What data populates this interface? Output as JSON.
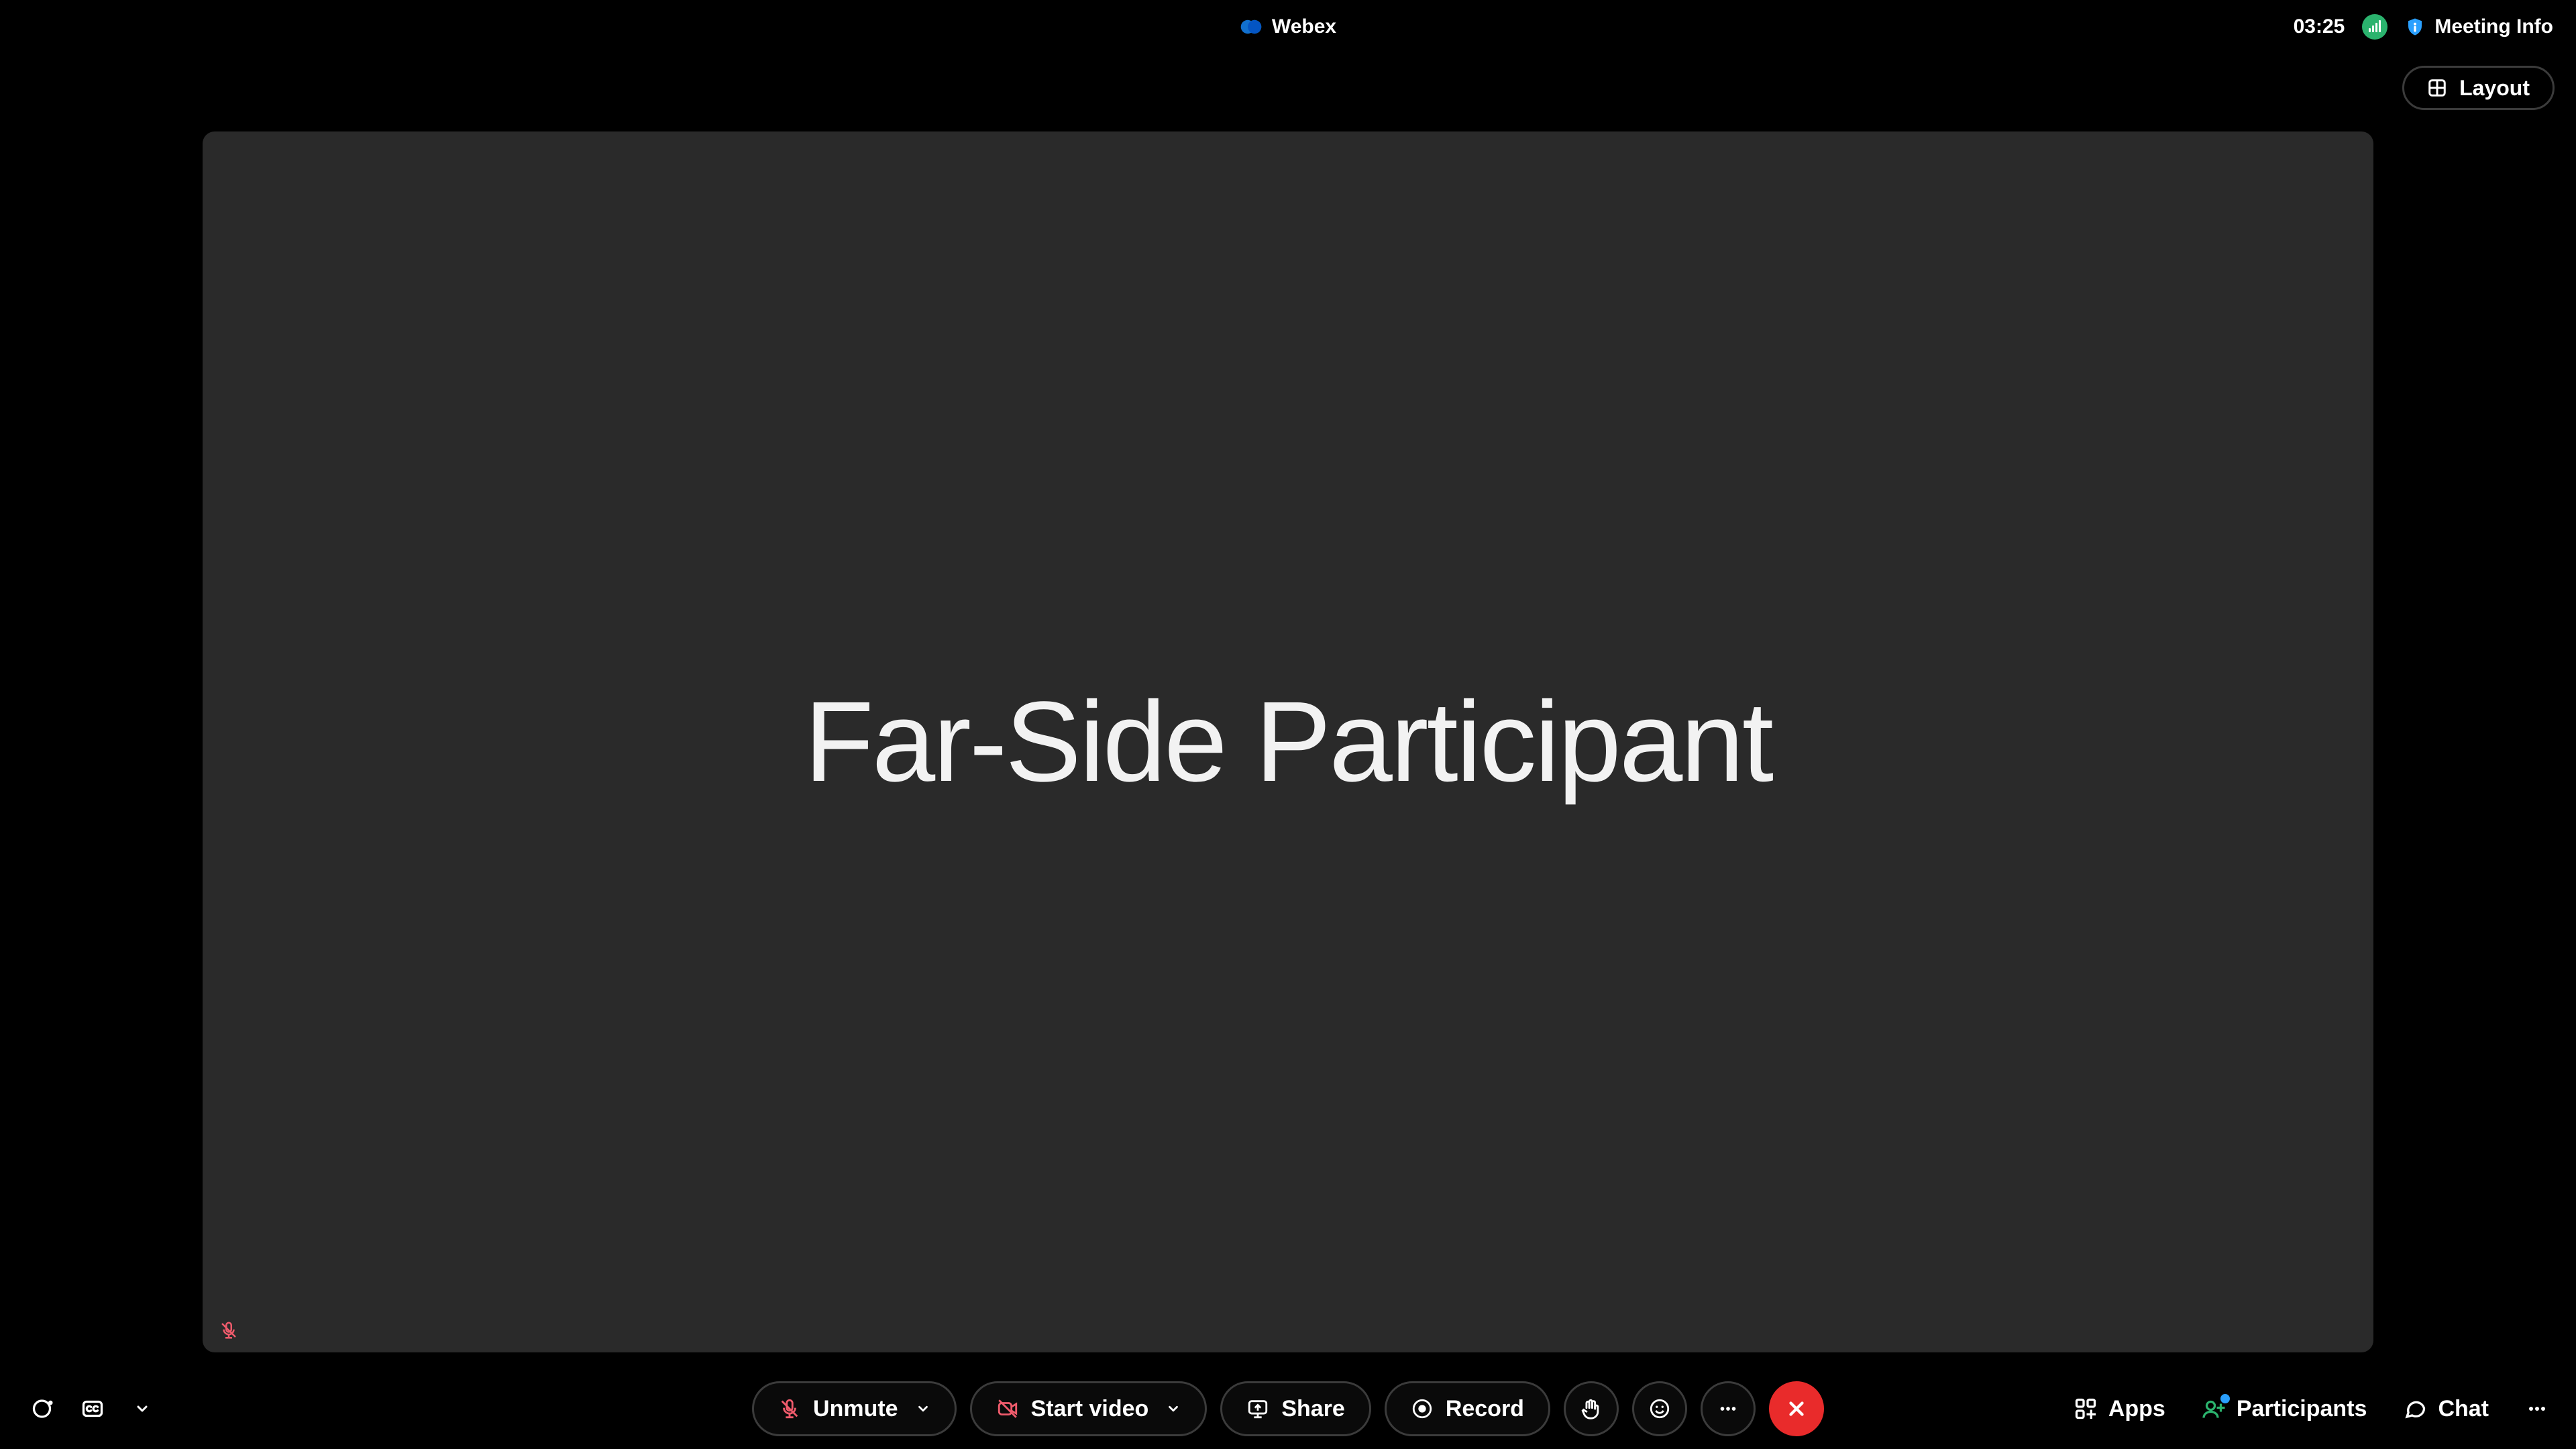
{
  "app": {
    "name": "Webex",
    "elapsed_time": "03:25",
    "meeting_info_label": "Meeting Info",
    "layout_label": "Layout"
  },
  "stage": {
    "participant_name": "Far-Side Participant"
  },
  "controls": {
    "unmute_label": "Unmute",
    "start_video_label": "Start video",
    "share_label": "Share",
    "record_label": "Record"
  },
  "right_actions": {
    "apps_label": "Apps",
    "participants_label": "Participants",
    "chat_label": "Chat"
  }
}
